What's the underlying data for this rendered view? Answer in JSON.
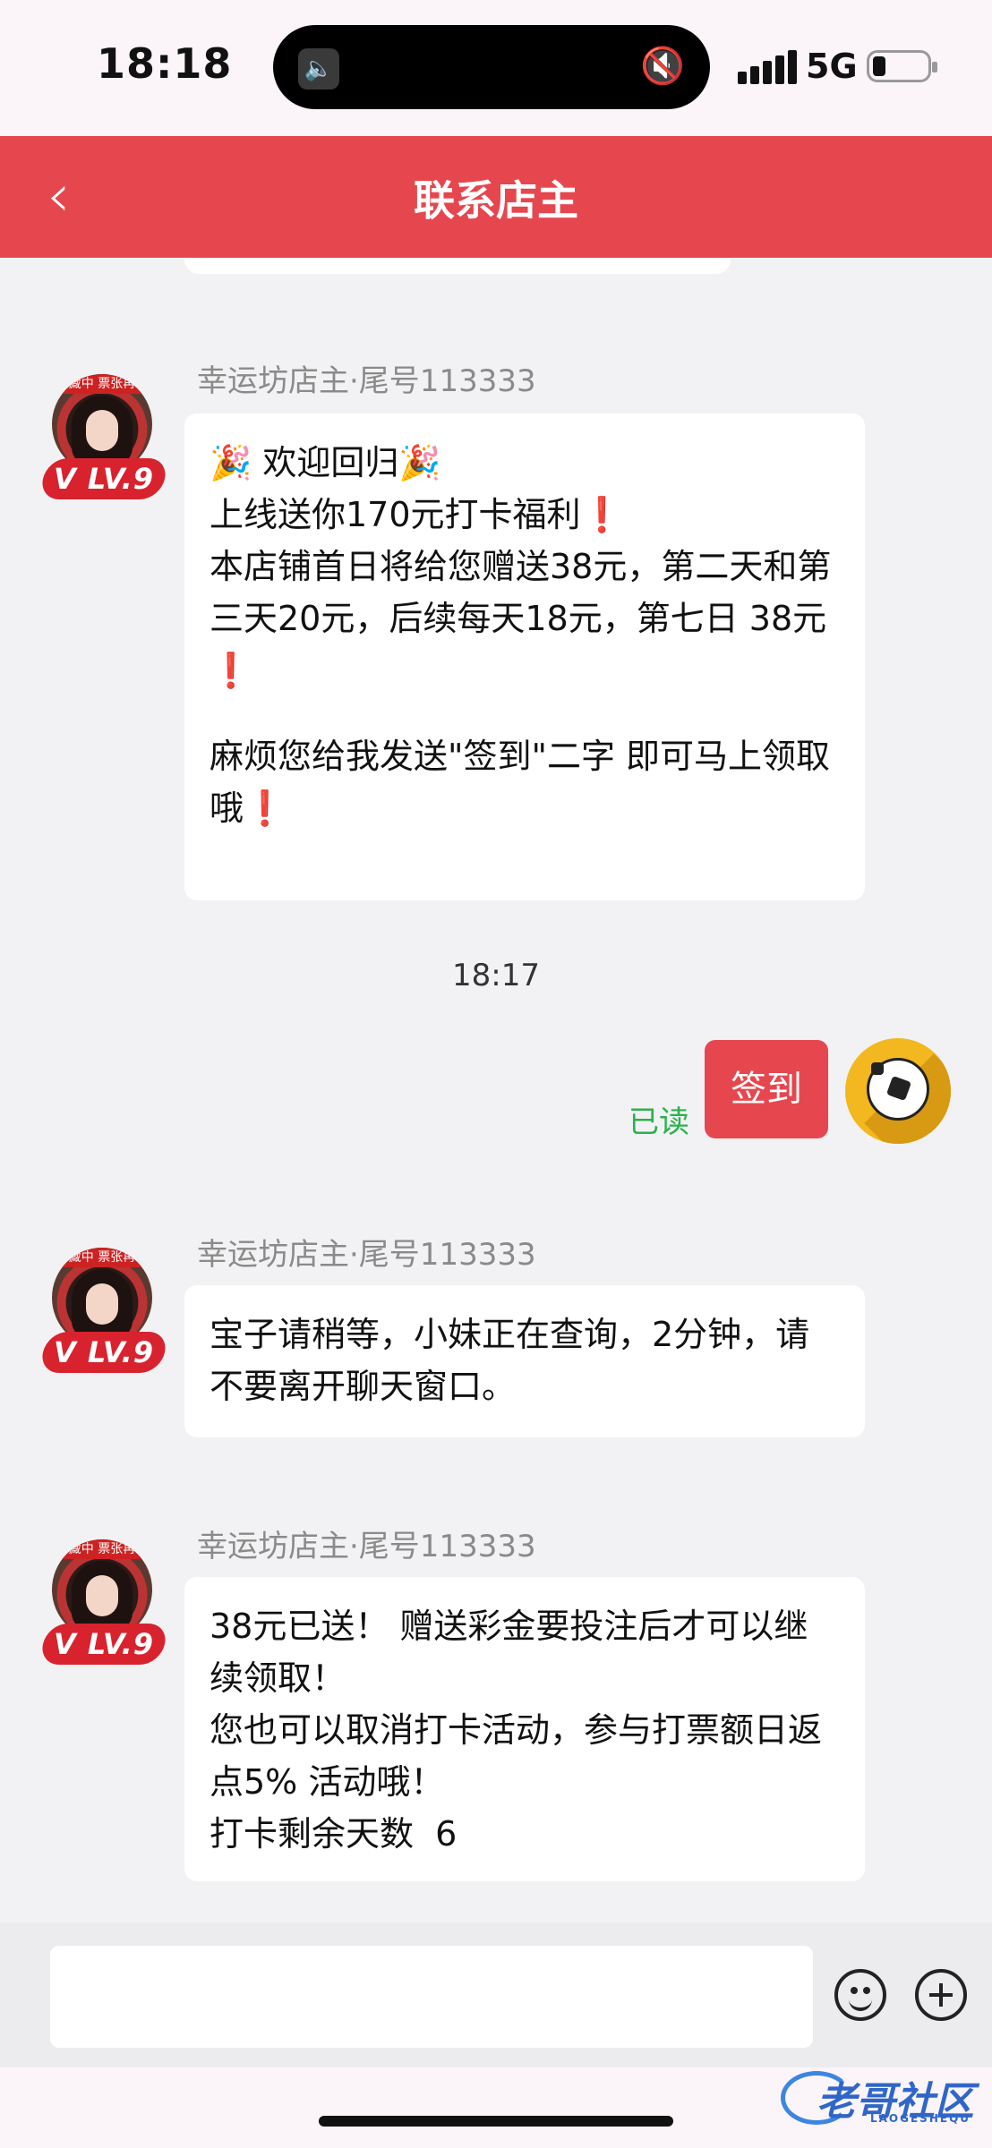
{
  "status": {
    "time": "18:18",
    "network": "5G"
  },
  "header": {
    "title": "联系店主",
    "back_icon": "chevron-left-icon"
  },
  "avatar_sign": "藏中  票张再",
  "messages": [
    {
      "sender": "幸运坊店主·尾号113333",
      "level": "LV.9",
      "lines": [
        "🎉 欢迎回归🎉",
        "上线送你170元打卡福利❗",
        "本店铺首日将给您赠送38元，第二天和第三天20元，后续每天18元，第七日 38元 ❗",
        "麻烦您给我发送\"签到\"二字 即可马上领取哦❗"
      ]
    },
    {
      "sender": "幸运坊店主·尾号113333",
      "level": "LV.9",
      "lines": [
        "宝子请稍等，小妹正在查询，2分钟，请不要离开聊天窗口。"
      ]
    },
    {
      "sender": "幸运坊店主·尾号113333",
      "level": "LV.9",
      "lines": [
        "38元已送！ 赠送彩金要投注后才可以继续领取！",
        "您也可以取消打卡活动，参与打票额日返点5% 活动哦！",
        "打卡剩余天数  6"
      ]
    }
  ],
  "timestamp": "18:17",
  "my_message": {
    "text": "签到",
    "read_status": "已读"
  },
  "input": {
    "placeholder": ""
  },
  "watermark": {
    "text": "老哥社区",
    "sub": "LAOGESHEQU"
  },
  "colors": {
    "accent": "#e6474f",
    "read": "#2bb24c",
    "background": "#f2f2f4"
  }
}
